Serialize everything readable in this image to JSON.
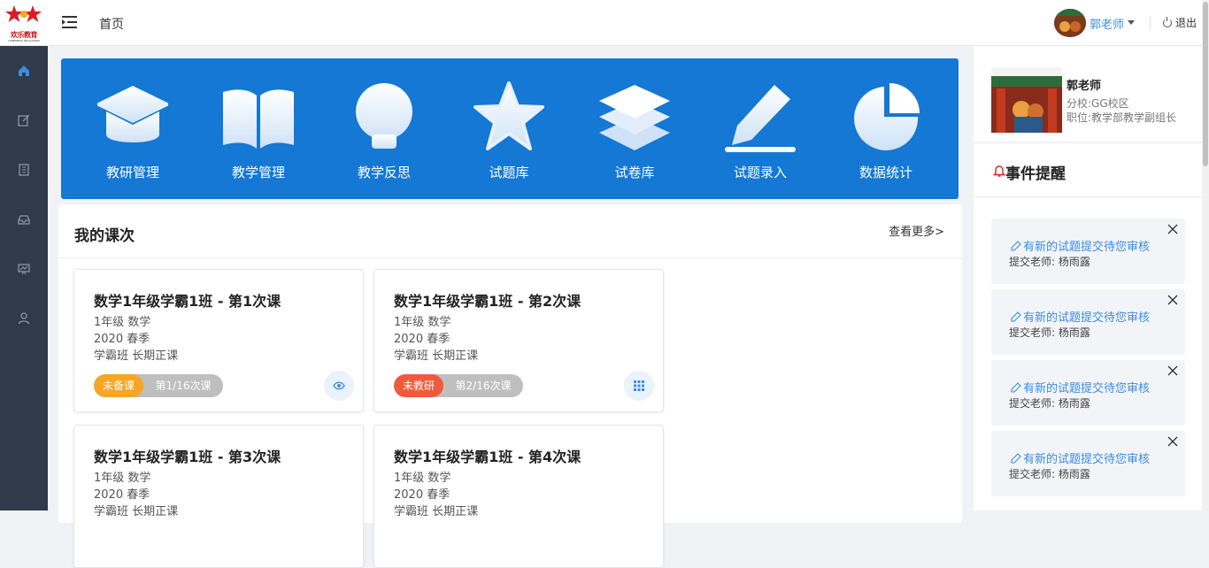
{
  "header": {
    "logo_text": "欢乐教育",
    "logo_sub": "HAPPINESS EDUCATION",
    "breadcrumb": "首页",
    "user_name": "郭老师",
    "logout": "退出"
  },
  "sidebar": {
    "items": [
      {
        "icon": "home-icon",
        "active": true
      },
      {
        "icon": "edit-icon",
        "active": false
      },
      {
        "icon": "building-icon",
        "active": false
      },
      {
        "icon": "inbox-icon",
        "active": false
      },
      {
        "icon": "presentation-icon",
        "active": false
      },
      {
        "icon": "user-icon",
        "active": false
      }
    ]
  },
  "banner": {
    "items": [
      {
        "label": "教研管理",
        "icon": "graduation-cap-icon"
      },
      {
        "label": "教学管理",
        "icon": "open-book-icon"
      },
      {
        "label": "教学反思",
        "icon": "lightbulb-icon"
      },
      {
        "label": "试题库",
        "icon": "star-icon"
      },
      {
        "label": "试卷库",
        "icon": "layers-icon"
      },
      {
        "label": "试题录入",
        "icon": "pencil-icon"
      },
      {
        "label": "数据统计",
        "icon": "pie-chart-icon"
      }
    ]
  },
  "courses": {
    "title": "我的课次",
    "more": "查看更多>",
    "cards": [
      {
        "title": "数学1年级学霸1班 - 第1次课",
        "grade": "1年级   数学",
        "term": "2020   春季",
        "type": "学霸班   长期正课",
        "status": "未备课",
        "status_color": "#f5a623",
        "count": "第1/16次课",
        "action_icon": "eye-icon"
      },
      {
        "title": "数学1年级学霸1班 - 第2次课",
        "grade": "1年级   数学",
        "term": "2020   春季",
        "type": "学霸班   长期正课",
        "status": "未教研",
        "status_color": "#f05a3c",
        "count": "第2/16次课",
        "action_icon": "grid-icon"
      },
      {
        "title": "数学1年级学霸1班 - 第3次课",
        "grade": "1年级   数学",
        "term": "2020   春季",
        "type": "学霸班   长期正课"
      },
      {
        "title": "数学1年级学霸1班 - 第4次课",
        "grade": "1年级   数学",
        "term": "2020   春季",
        "type": "学霸班   长期正课"
      }
    ]
  },
  "profile": {
    "name": "郭老师",
    "campus": "分校:GG校区",
    "role": "职位:教学部教学副组长"
  },
  "events": {
    "title": "事件提醒",
    "items": [
      {
        "title": "有新的试题提交待您审核",
        "teacher": "提交老师: 杨雨露"
      },
      {
        "title": "有新的试题提交待您审核",
        "teacher": "提交老师: 杨雨露"
      },
      {
        "title": "有新的试题提交待您审核",
        "teacher": "提交老师: 杨雨露"
      },
      {
        "title": "有新的试题提交待您审核",
        "teacher": "提交老师: 杨雨露"
      }
    ]
  },
  "colors": {
    "banner": "#1478d4",
    "sidebar": "#2f3a4a",
    "accent": "#3b8de0"
  }
}
